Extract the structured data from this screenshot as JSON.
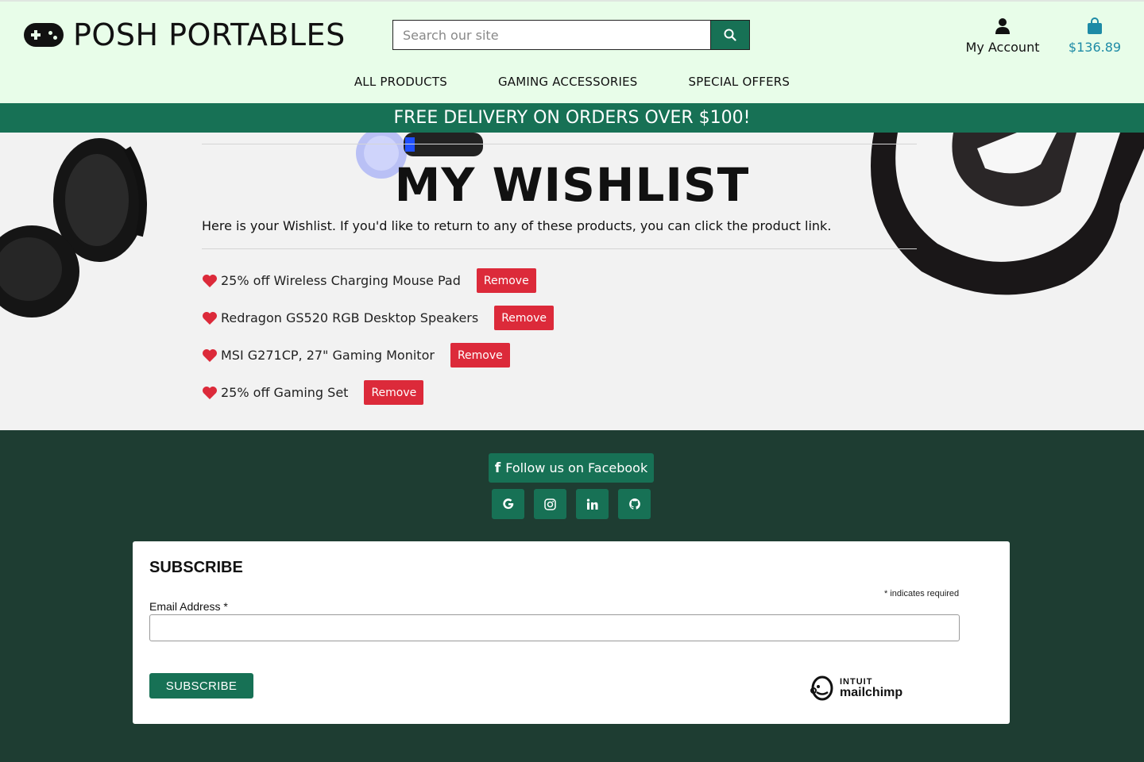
{
  "header": {
    "logo_text": "POSH PORTABLES",
    "search_placeholder": "Search our site",
    "account_label": "My Account",
    "bag_amount": "$136.89"
  },
  "nav": {
    "items": [
      "ALL PRODUCTS",
      "GAMING ACCESSORIES",
      "SPECIAL OFFERS"
    ]
  },
  "banner": "FREE DELIVERY ON ORDERS OVER $100!",
  "wishlist": {
    "title": "MY WISHLIST",
    "intro": "Here is your Wishlist. If you'd like to return to any of these products, you can click the product link.",
    "remove_label": "Remove",
    "items": [
      {
        "name": "25% off Wireless Charging Mouse Pad"
      },
      {
        "name": "Redragon GS520 RGB Desktop Speakers"
      },
      {
        "name": "MSI G271CP, 27\" Gaming Monitor"
      },
      {
        "name": "25% off Gaming Set"
      }
    ]
  },
  "footer": {
    "facebook_label": "Follow us on Facebook",
    "social_icons": [
      "google-icon",
      "instagram-icon",
      "linkedin-icon",
      "github-icon"
    ]
  },
  "subscribe": {
    "title": "SUBSCRIBE",
    "required_note": "* indicates required",
    "email_label": "Email Address *",
    "button_label": "SUBSCRIBE",
    "badge_line1": "INTUIT",
    "badge_line2": "mailchimp"
  },
  "colors": {
    "primary_green": "#177155",
    "footer_bg": "#1e3d32",
    "header_bg": "#e8fde9",
    "danger": "#dc2a3a",
    "bag_blue": "#1d8ba6"
  }
}
